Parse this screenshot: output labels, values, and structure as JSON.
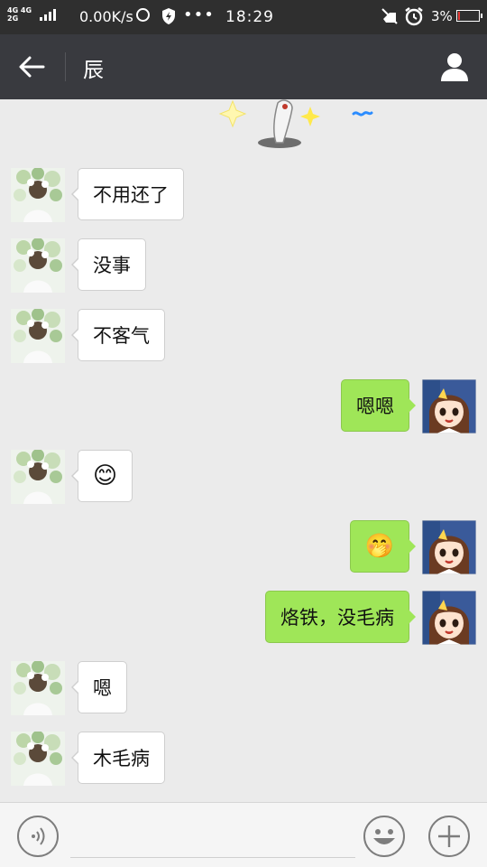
{
  "status_bar": {
    "network_top": "4G 4G",
    "network_bottom": "2G",
    "network_extra": "2G",
    "speed": "0.00K/s",
    "time": "18:29",
    "battery": "3%",
    "more_icon": "•••"
  },
  "header": {
    "title": "辰",
    "back_icon": "back-arrow-icon",
    "profile_icon": "person-icon"
  },
  "messages": [
    {
      "side": "in",
      "text": "不用还了"
    },
    {
      "side": "in",
      "text": "没事"
    },
    {
      "side": "in",
      "text": "不客气"
    },
    {
      "side": "out",
      "text": "嗯嗯"
    },
    {
      "side": "in",
      "text": "😊"
    },
    {
      "side": "out",
      "text": "🤭"
    },
    {
      "side": "out",
      "text": "烙铁，没毛病"
    },
    {
      "side": "in",
      "text": "嗯"
    },
    {
      "side": "in",
      "text": "木毛病"
    }
  ],
  "input_bar": {
    "voice_icon": "voice-icon",
    "emoji_icon": "emoji-icon",
    "plus_icon": "plus-icon",
    "placeholder": ""
  },
  "colors": {
    "status_bar": "#2f2f2f",
    "header": "#393a3f",
    "chat_background": "#ebebeb",
    "incoming_bubble": "#ffffff",
    "outgoing_bubble": "#9fe658"
  }
}
